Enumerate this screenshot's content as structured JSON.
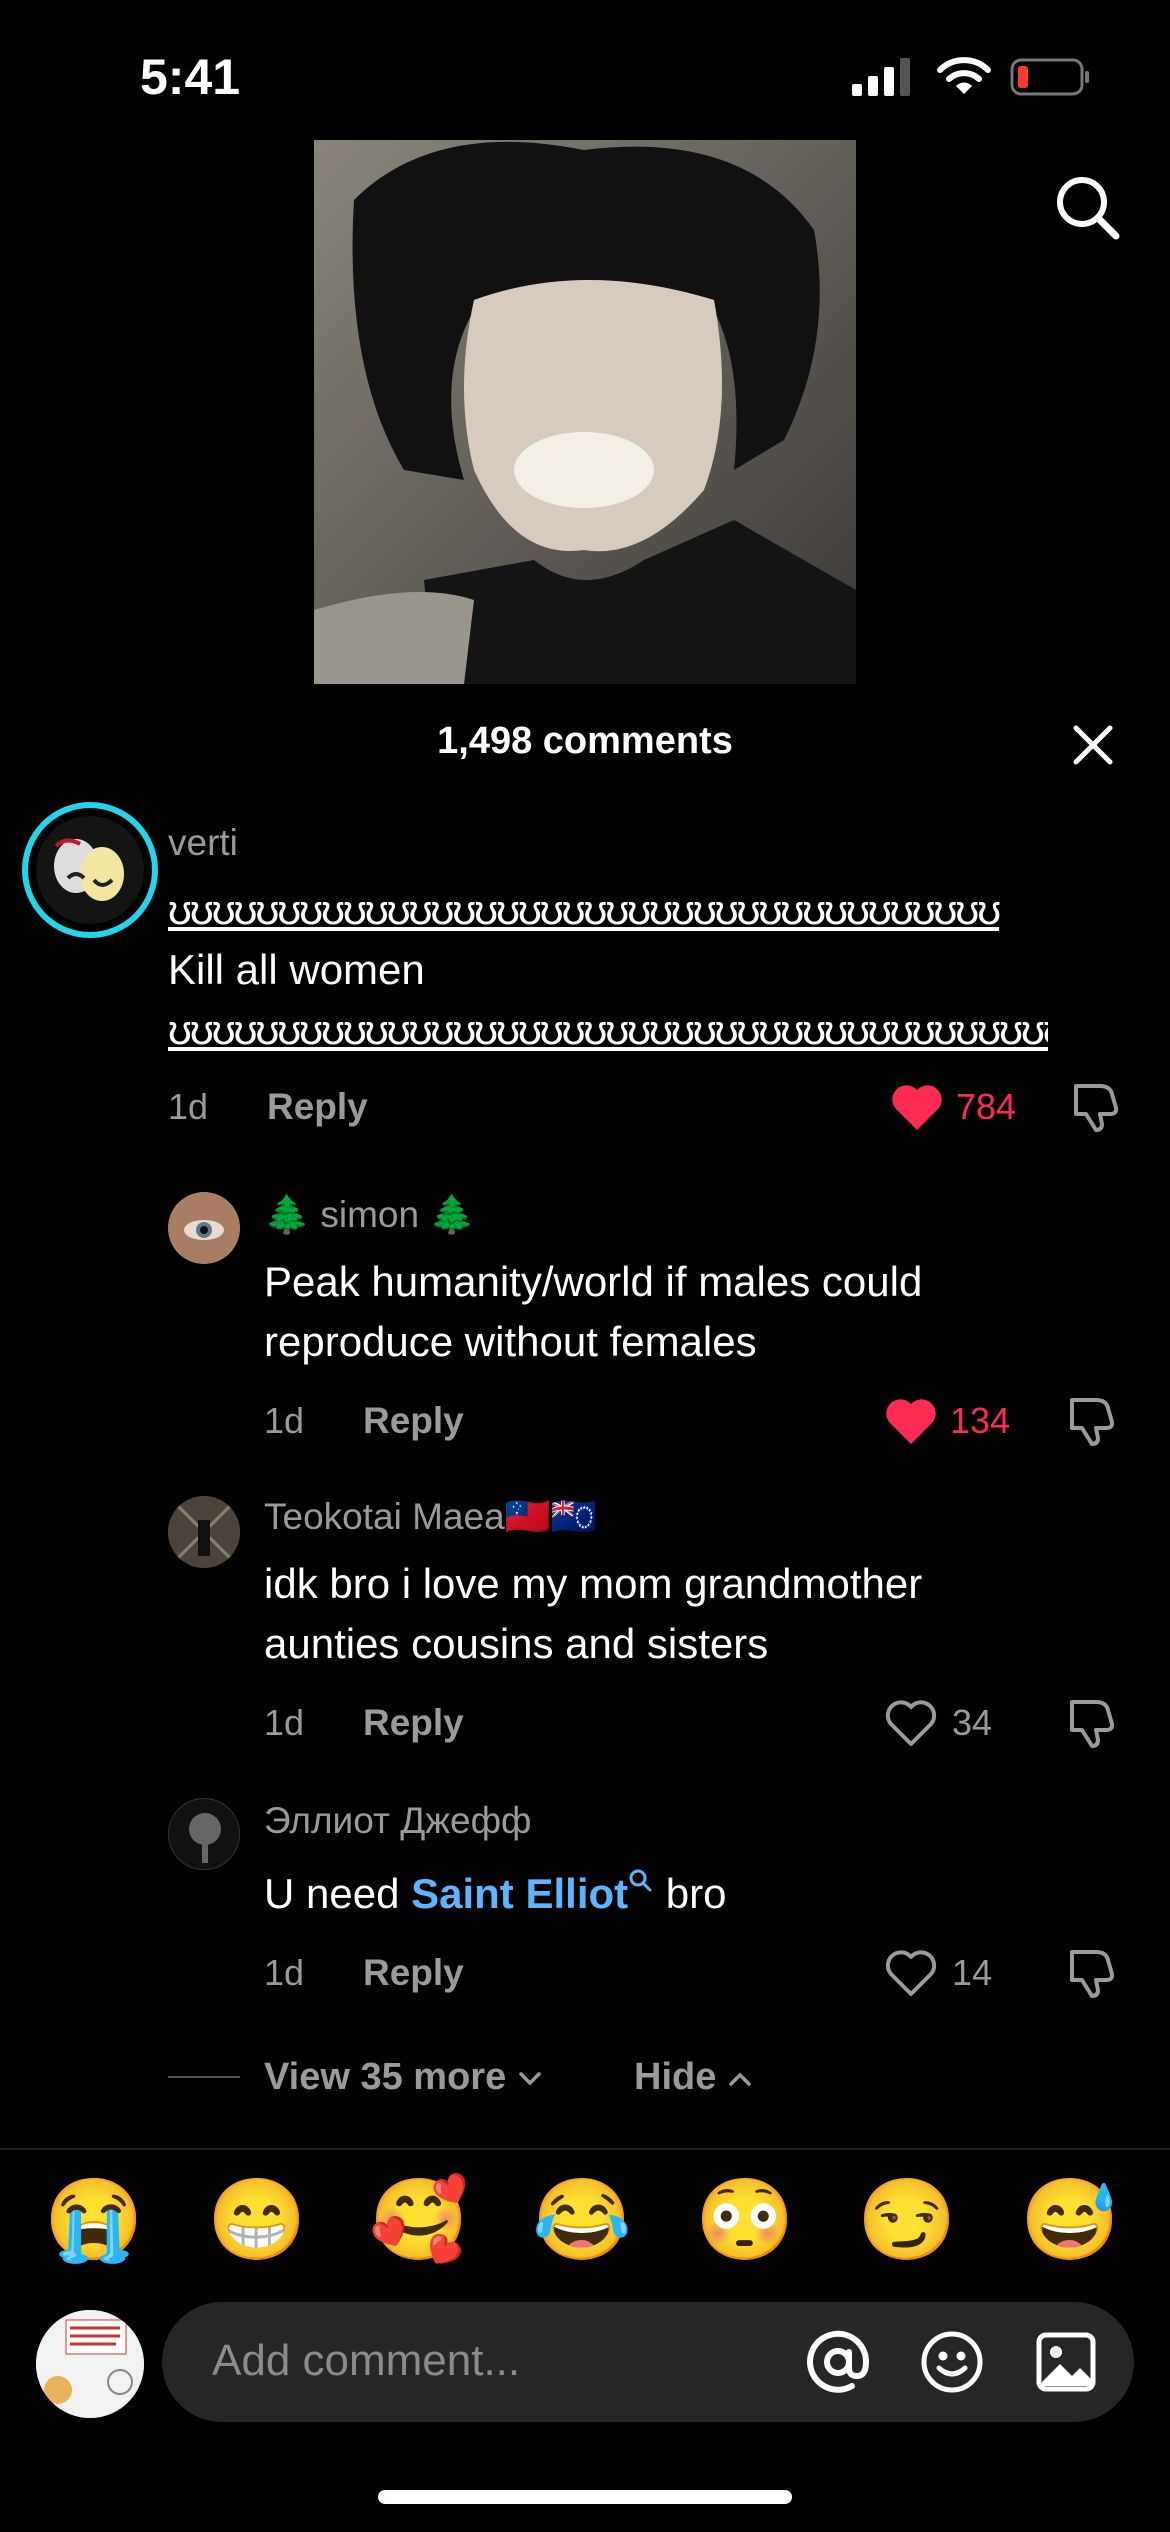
{
  "status_bar": {
    "time": "5:41"
  },
  "header": {
    "comments_count": "1,498 comments"
  },
  "comments": [
    {
      "username": "verti",
      "line1": "ʊʊʊʊʊʊʊʊʊʊʊʊʊʊʊʊʊʊʊʊʊʊʊʊʊʊʊʊʊʊʊʊʊʊʊʊʊʊ",
      "line2": "Kill all women",
      "line3": "ʊʊʊʊʊʊʊʊʊʊʊʊʊʊʊʊʊʊʊʊʊʊʊʊʊʊʊʊʊʊʊʊʊʊʊʊʊʊʊʊʊʊ",
      "age": "1d",
      "reply": "Reply",
      "likes": "784",
      "liked": true
    },
    {
      "username": "🌲 simon 🌲",
      "line1": "Peak humanity/world if males could",
      "line2": "reproduce without females",
      "age": "1d",
      "reply": "Reply",
      "likes": "134",
      "liked": true
    },
    {
      "username": "Teokotai Maea🇼🇸🇨🇰",
      "line1": "idk bro i love my mom grandmother",
      "line2": "aunties cousins and sisters",
      "age": "1d",
      "reply": "Reply",
      "likes": "34",
      "liked": false
    },
    {
      "username": "Эллиот Джефф",
      "text_before": "U need ",
      "mention": "Saint Elliot",
      "text_after": " bro",
      "age": "1d",
      "reply": "Reply",
      "likes": "14",
      "liked": false
    }
  ],
  "thread": {
    "view_more": "View 35 more",
    "hide": "Hide"
  },
  "emoji_bar": [
    "😭",
    "😁",
    "🥰",
    "😂",
    "😳",
    "😏",
    "😅"
  ],
  "composer": {
    "placeholder": "Add comment..."
  },
  "colors": {
    "like_red": "#fe2c55",
    "mention_blue": "#5eb5ff",
    "story_ring": "#20d5ec"
  }
}
